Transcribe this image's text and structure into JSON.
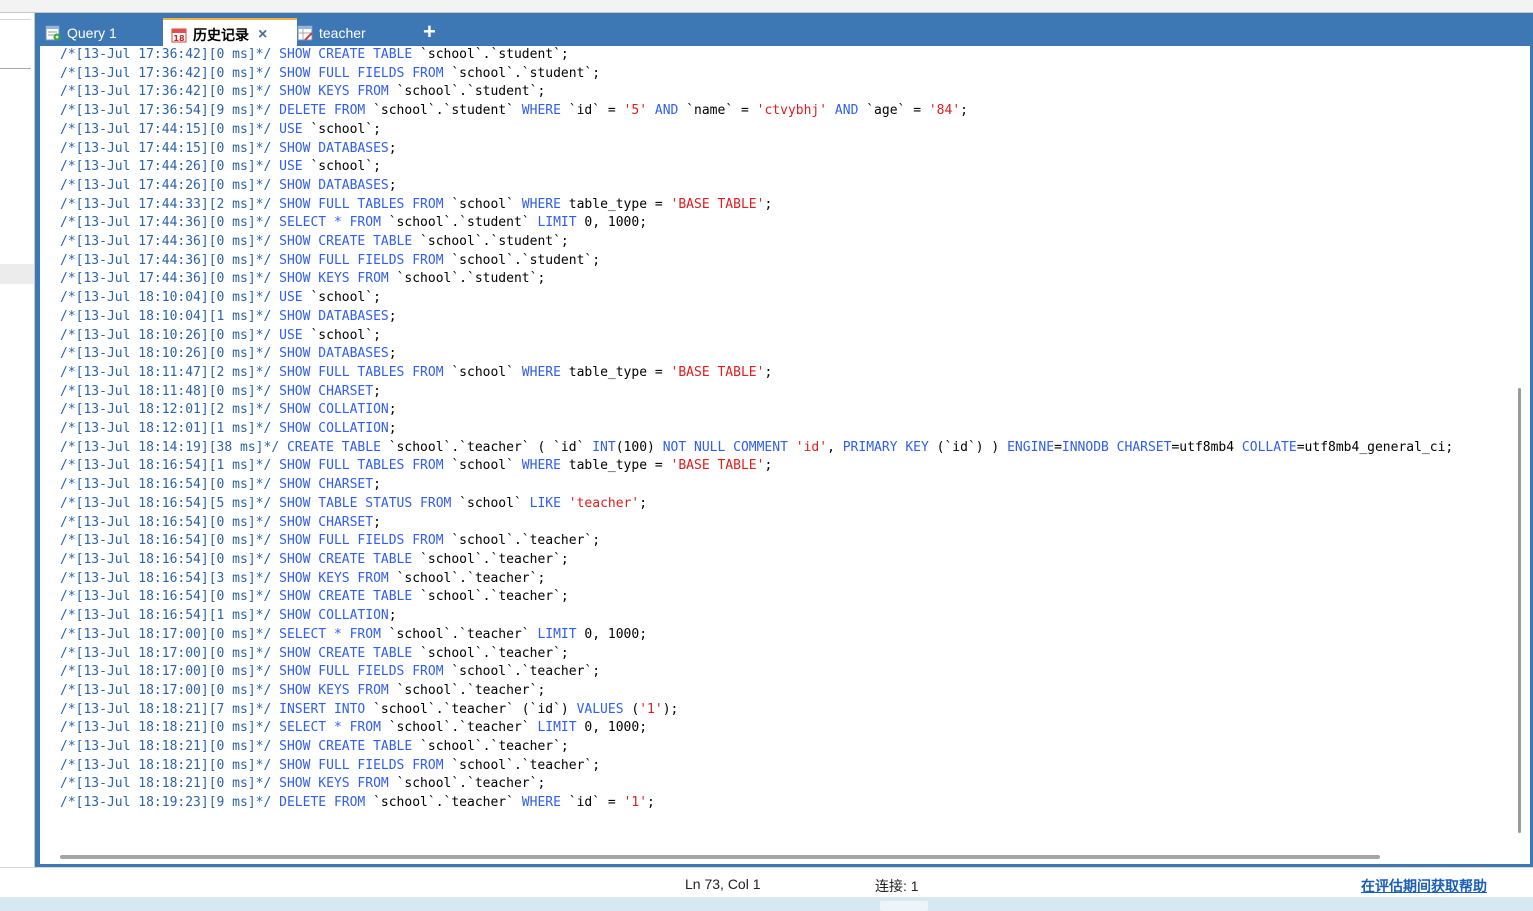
{
  "tabs": [
    {
      "label": "Query 1",
      "icon": "query-icon",
      "active": false
    },
    {
      "label": "历史记录",
      "icon": "calendar-icon",
      "active": true,
      "icon_text": "18"
    },
    {
      "label": "teacher",
      "icon": "table-edit-icon",
      "active": false
    }
  ],
  "tab_close": "×",
  "tab_add": "+",
  "log_lines": [
    [
      "c",
      "/*[13-Jul 17:36:42][0 ms]*/ ",
      "k",
      "SHOW CREATE TABLE ",
      "t",
      "`school`.`student`;"
    ],
    [
      "c",
      "/*[13-Jul 17:36:42][0 ms]*/ ",
      "k",
      "SHOW FULL FIELDS FROM ",
      "t",
      "`school`.`student`;"
    ],
    [
      "c",
      "/*[13-Jul 17:36:42][0 ms]*/ ",
      "k",
      "SHOW KEYS FROM ",
      "t",
      "`school`.`student`;"
    ],
    [
      "c",
      "/*[13-Jul 17:36:54][9 ms]*/ ",
      "k",
      "DELETE FROM ",
      "t",
      "`school`.`student` ",
      "k",
      "WHERE ",
      "t",
      "`id` = ",
      "s",
      "'5' ",
      "k",
      "AND ",
      "t",
      "`name` = ",
      "s",
      "'ctvybhj' ",
      "k",
      "AND ",
      "t",
      "`age` = ",
      "s",
      "'84'",
      "t",
      ";"
    ],
    [
      "c",
      "/*[13-Jul 17:44:15][0 ms]*/ ",
      "k",
      "USE ",
      "t",
      "`school`;"
    ],
    [
      "c",
      "/*[13-Jul 17:44:15][0 ms]*/ ",
      "k",
      "SHOW DATABASES",
      "t",
      ";"
    ],
    [
      "c",
      "/*[13-Jul 17:44:26][0 ms]*/ ",
      "k",
      "USE ",
      "t",
      "`school`;"
    ],
    [
      "c",
      "/*[13-Jul 17:44:26][0 ms]*/ ",
      "k",
      "SHOW DATABASES",
      "t",
      ";"
    ],
    [
      "c",
      "/*[13-Jul 17:44:33][2 ms]*/ ",
      "k",
      "SHOW FULL TABLES FROM ",
      "t",
      "`school` ",
      "k",
      "WHERE ",
      "t",
      "table_type = ",
      "s",
      "'BASE TABLE'",
      "t",
      ";"
    ],
    [
      "c",
      "/*[13-Jul 17:44:36][0 ms]*/ ",
      "k",
      "SELECT * FROM ",
      "t",
      "`school`.`student` ",
      "k",
      "LIMIT ",
      "t",
      "0, 1000;"
    ],
    [
      "c",
      "/*[13-Jul 17:44:36][0 ms]*/ ",
      "k",
      "SHOW CREATE TABLE ",
      "t",
      "`school`.`student`;"
    ],
    [
      "c",
      "/*[13-Jul 17:44:36][0 ms]*/ ",
      "k",
      "SHOW FULL FIELDS FROM ",
      "t",
      "`school`.`student`;"
    ],
    [
      "c",
      "/*[13-Jul 17:44:36][0 ms]*/ ",
      "k",
      "SHOW KEYS FROM ",
      "t",
      "`school`.`student`;"
    ],
    [
      "c",
      "/*[13-Jul 18:10:04][0 ms]*/ ",
      "k",
      "USE ",
      "t",
      "`school`;"
    ],
    [
      "c",
      "/*[13-Jul 18:10:04][1 ms]*/ ",
      "k",
      "SHOW DATABASES",
      "t",
      ";"
    ],
    [
      "c",
      "/*[13-Jul 18:10:26][0 ms]*/ ",
      "k",
      "USE ",
      "t",
      "`school`;"
    ],
    [
      "c",
      "/*[13-Jul 18:10:26][0 ms]*/ ",
      "k",
      "SHOW DATABASES",
      "t",
      ";"
    ],
    [
      "c",
      "/*[13-Jul 18:11:47][2 ms]*/ ",
      "k",
      "SHOW FULL TABLES FROM ",
      "t",
      "`school` ",
      "k",
      "WHERE ",
      "t",
      "table_type = ",
      "s",
      "'BASE TABLE'",
      "t",
      ";"
    ],
    [
      "c",
      "/*[13-Jul 18:11:48][0 ms]*/ ",
      "k",
      "SHOW CHARSET",
      "t",
      ";"
    ],
    [
      "c",
      "/*[13-Jul 18:12:01][2 ms]*/ ",
      "k",
      "SHOW COLLATION",
      "t",
      ";"
    ],
    [
      "c",
      "/*[13-Jul 18:12:01][1 ms]*/ ",
      "k",
      "SHOW COLLATION",
      "t",
      ";"
    ],
    [
      "c",
      "/*[13-Jul 18:14:19][38 ms]*/ ",
      "k",
      "CREATE TABLE ",
      "t",
      "`school`.`teacher` ( `id` ",
      "k",
      "INT",
      "t",
      "(100) ",
      "k",
      "NOT NULL COMMENT ",
      "s",
      "'id'",
      "t",
      ", ",
      "k",
      "PRIMARY KEY ",
      "t",
      "(`id`) ) ",
      "k",
      "ENGINE",
      "t",
      "=",
      "k",
      "INNODB CHARSET",
      "t",
      "=utf8mb4 ",
      "k",
      "COLLATE",
      "t",
      "=utf8mb4_general_ci;"
    ],
    [
      "c",
      "/*[13-Jul 18:16:54][1 ms]*/ ",
      "k",
      "SHOW FULL TABLES FROM ",
      "t",
      "`school` ",
      "k",
      "WHERE ",
      "t",
      "table_type = ",
      "s",
      "'BASE TABLE'",
      "t",
      ";"
    ],
    [
      "c",
      "/*[13-Jul 18:16:54][0 ms]*/ ",
      "k",
      "SHOW CHARSET",
      "t",
      ";"
    ],
    [
      "c",
      "/*[13-Jul 18:16:54][5 ms]*/ ",
      "k",
      "SHOW TABLE STATUS FROM ",
      "t",
      "`school` ",
      "k",
      "LIKE ",
      "s",
      "'teacher'",
      "t",
      ";"
    ],
    [
      "c",
      "/*[13-Jul 18:16:54][0 ms]*/ ",
      "k",
      "SHOW CHARSET",
      "t",
      ";"
    ],
    [
      "c",
      "/*[13-Jul 18:16:54][0 ms]*/ ",
      "k",
      "SHOW FULL FIELDS FROM ",
      "t",
      "`school`.`teacher`;"
    ],
    [
      "c",
      "/*[13-Jul 18:16:54][0 ms]*/ ",
      "k",
      "SHOW CREATE TABLE ",
      "t",
      "`school`.`teacher`;"
    ],
    [
      "c",
      "/*[13-Jul 18:16:54][3 ms]*/ ",
      "k",
      "SHOW KEYS FROM ",
      "t",
      "`school`.`teacher`;"
    ],
    [
      "c",
      "/*[13-Jul 18:16:54][0 ms]*/ ",
      "k",
      "SHOW CREATE TABLE ",
      "t",
      "`school`.`teacher`;"
    ],
    [
      "c",
      "/*[13-Jul 18:16:54][1 ms]*/ ",
      "k",
      "SHOW COLLATION",
      "t",
      ";"
    ],
    [
      "c",
      "/*[13-Jul 18:17:00][0 ms]*/ ",
      "k",
      "SELECT * FROM ",
      "t",
      "`school`.`teacher` ",
      "k",
      "LIMIT ",
      "t",
      "0, 1000;"
    ],
    [
      "c",
      "/*[13-Jul 18:17:00][0 ms]*/ ",
      "k",
      "SHOW CREATE TABLE ",
      "t",
      "`school`.`teacher`;"
    ],
    [
      "c",
      "/*[13-Jul 18:17:00][0 ms]*/ ",
      "k",
      "SHOW FULL FIELDS FROM ",
      "t",
      "`school`.`teacher`;"
    ],
    [
      "c",
      "/*[13-Jul 18:17:00][0 ms]*/ ",
      "k",
      "SHOW KEYS FROM ",
      "t",
      "`school`.`teacher`;"
    ],
    [
      "c",
      "/*[13-Jul 18:18:21][7 ms]*/ ",
      "k",
      "INSERT INTO ",
      "t",
      "`school`.`teacher` (`id`) ",
      "k",
      "VALUES ",
      "t",
      "(",
      "s",
      "'1'",
      "t",
      ");"
    ],
    [
      "c",
      "/*[13-Jul 18:18:21][0 ms]*/ ",
      "k",
      "SELECT * FROM ",
      "t",
      "`school`.`teacher` ",
      "k",
      "LIMIT ",
      "t",
      "0, 1000;"
    ],
    [
      "c",
      "/*[13-Jul 18:18:21][0 ms]*/ ",
      "k",
      "SHOW CREATE TABLE ",
      "t",
      "`school`.`teacher`;"
    ],
    [
      "c",
      "/*[13-Jul 18:18:21][0 ms]*/ ",
      "k",
      "SHOW FULL FIELDS FROM ",
      "t",
      "`school`.`teacher`;"
    ],
    [
      "c",
      "/*[13-Jul 18:18:21][0 ms]*/ ",
      "k",
      "SHOW KEYS FROM ",
      "t",
      "`school`.`teacher`;"
    ],
    [
      "c",
      "/*[13-Jul 18:19:23][9 ms]*/ ",
      "k",
      "DELETE FROM ",
      "t",
      "`school`.`teacher` ",
      "k",
      "WHERE ",
      "t",
      "`id` = ",
      "s",
      "'1'",
      "t",
      ";"
    ]
  ],
  "status": {
    "position": "Ln 73, Col 1",
    "connection": "连接: 1",
    "help_link": "在评估期间获取帮助"
  },
  "colors": {
    "tab_bar": "#3d78b5",
    "comment": "#2a63a8",
    "keyword": "#2f5ef0",
    "string": "#e01d1d"
  }
}
